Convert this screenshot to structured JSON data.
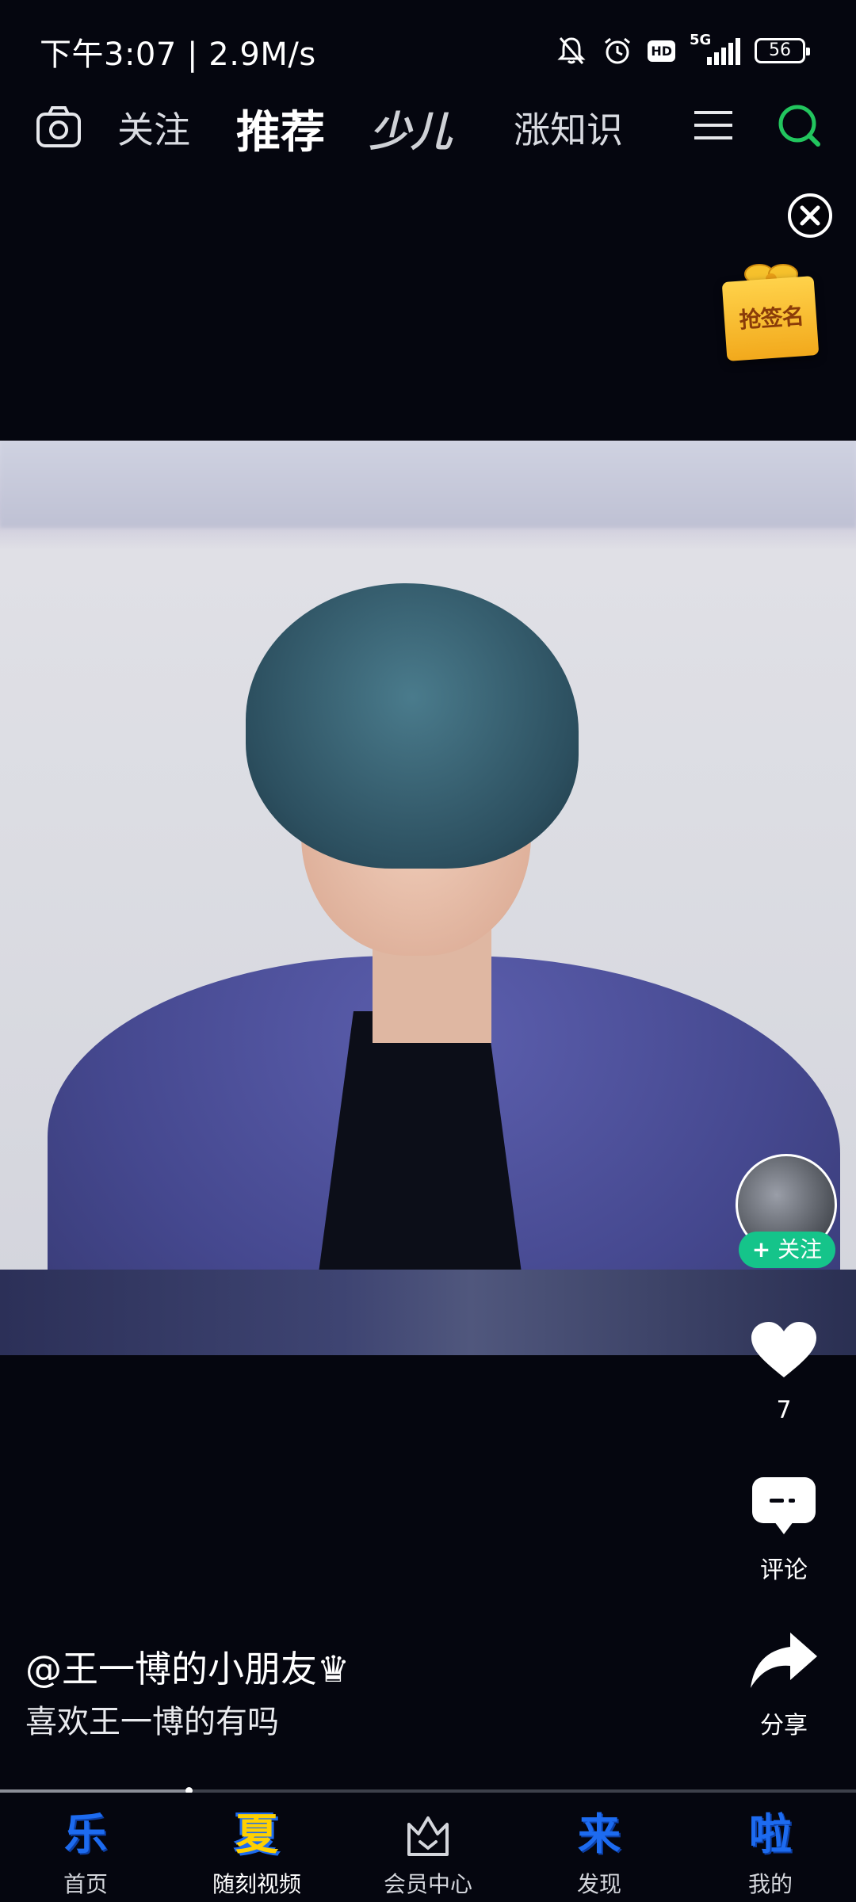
{
  "status_bar": {
    "time": "下午3:07",
    "network_speed": "2.9M/s",
    "hd": "HD",
    "network": "5G",
    "battery": "56"
  },
  "top_nav": {
    "tabs": [
      "关注",
      "推荐",
      "少儿",
      "涨知识"
    ],
    "active_tab": "推荐"
  },
  "promo": {
    "gift_label": "抢签名"
  },
  "video": {
    "author": "@王一博的小朋友♛",
    "caption": "喜欢王一博的有吗",
    "follow_label": "关注",
    "like_count": "7",
    "comment_label": "评论",
    "share_label": "分享",
    "progress": 0.22
  },
  "bottom_nav": {
    "items": [
      {
        "glyph": "乐",
        "label": "首页"
      },
      {
        "glyph": "夏",
        "label": "随刻视频"
      },
      {
        "glyph": "",
        "label": "会员中心"
      },
      {
        "glyph": "来",
        "label": "发现"
      },
      {
        "glyph": "啦",
        "label": "我的"
      }
    ]
  },
  "colors": {
    "accent_green": "#15c48a",
    "search_green": "#22c55e",
    "brand_blue": "#1d6bf0",
    "background": "#05060f"
  }
}
